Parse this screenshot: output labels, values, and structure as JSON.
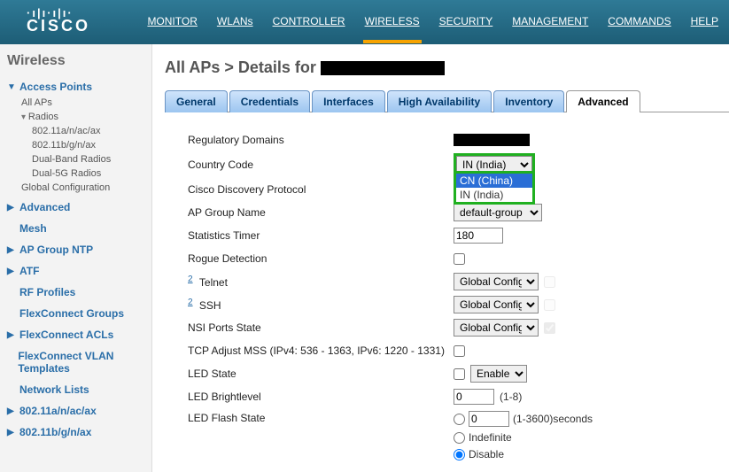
{
  "topnav": {
    "items": [
      "MONITOR",
      "WLANs",
      "CONTROLLER",
      "WIRELESS",
      "SECURITY",
      "MANAGEMENT",
      "COMMANDS",
      "HELP"
    ],
    "active_index": 3
  },
  "logo": "CISCO",
  "sidebar": {
    "title": "Wireless",
    "access_points": {
      "label": "Access Points",
      "all_aps": "All APs",
      "radios": {
        "label": "Radios",
        "items": [
          "802.11a/n/ac/ax",
          "802.11b/g/n/ax",
          "Dual-Band Radios",
          "Dual-5G Radios"
        ]
      },
      "global_config": "Global Configuration"
    },
    "items": [
      "Advanced",
      "Mesh",
      "AP Group NTP",
      "ATF",
      "RF Profiles",
      "FlexConnect Groups",
      "FlexConnect ACLs",
      "FlexConnect VLAN Templates",
      "Network Lists",
      "802.11a/n/ac/ax",
      "802.11b/g/n/ax"
    ]
  },
  "page": {
    "breadcrumb_prefix": "All APs > Details for "
  },
  "tabs": [
    "General",
    "Credentials",
    "Interfaces",
    "High Availability",
    "Inventory",
    "Advanced"
  ],
  "active_tab": 5,
  "form": {
    "regulatory_domains": {
      "label": "Regulatory Domains"
    },
    "country_code": {
      "label": "Country Code",
      "selected": "IN (India)",
      "options": [
        "CN (China)",
        "IN (India)"
      ],
      "open_highlight": 0
    },
    "cdp": {
      "label": "Cisco Discovery Protocol"
    },
    "ap_group": {
      "label": "AP Group Name",
      "value": "default-group"
    },
    "stats_timer": {
      "label": "Statistics Timer",
      "value": "180"
    },
    "rogue": {
      "label": "Rogue Detection",
      "checked": false
    },
    "telnet": {
      "label": "Telnet",
      "value": "Global Config"
    },
    "ssh": {
      "label": "SSH",
      "value": "Global Config"
    },
    "nsi": {
      "label": "NSI Ports State",
      "value": "Global Config"
    },
    "mss": {
      "label": "TCP Adjust MSS (IPv4: 536 - 1363, IPv6: 1220 - 1331)",
      "checked": false
    },
    "led_state": {
      "label": "LED State",
      "checked": false,
      "mode": "Enable"
    },
    "led_bright": {
      "label": "LED Brightlevel",
      "value": "0",
      "hint": "(1-8)"
    },
    "led_flash": {
      "label": "LED Flash State",
      "seconds_value": "0",
      "seconds_hint": "(1-3600)seconds",
      "indefinite_label": "Indefinite",
      "disable_label": "Disable",
      "selected": "disable"
    }
  }
}
